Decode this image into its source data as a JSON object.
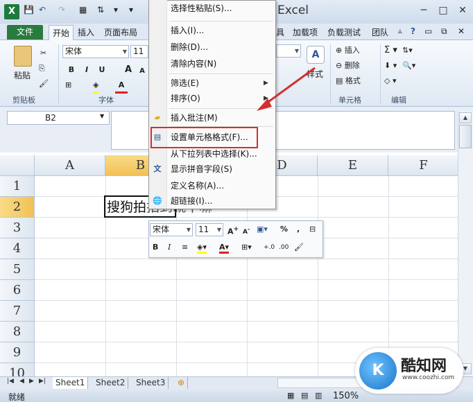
{
  "window": {
    "title": "Excel",
    "logo_letter": "X",
    "controls": [
      "─",
      "□",
      "✕"
    ]
  },
  "ribbon": {
    "file_tab": "文件",
    "tabs_left": [
      "开始",
      "插入",
      "页面布局"
    ],
    "tabs_right": [
      "具",
      "加载项",
      "负载测试",
      "团队"
    ],
    "paste_label": "粘贴",
    "group_clipboard": "剪贴板",
    "group_font": "字体",
    "group_cells": "单元格",
    "group_edit": "编辑",
    "font_name": "宋体",
    "font_size": "11",
    "bold": "B",
    "italic": "I",
    "underline": "U",
    "grow_font": "A",
    "shrink_font": "A",
    "font_color": "A",
    "style_label": "样式",
    "insert_cell": "插入",
    "delete_cell": "删除",
    "format_cell": "格式"
  },
  "formula_bar": {
    "name_box": "B2"
  },
  "grid": {
    "columns": [
      "A",
      "B",
      "C",
      "D",
      "E",
      "F"
    ],
    "rows": [
      "1",
      "2",
      "3",
      "4",
      "5",
      "6",
      "7",
      "8",
      "9",
      "10"
    ],
    "selected_column": "B",
    "selected_row": "2",
    "cell_b2_visible": "搜狗拍",
    "cell_overflow_visible": "拍到就干嘛"
  },
  "context_menu": {
    "items": [
      {
        "label": "选择性粘贴(S)...",
        "submenu": false
      },
      {
        "label": "插入(I)...",
        "submenu": false
      },
      {
        "label": "删除(D)...",
        "submenu": false
      },
      {
        "label": "清除内容(N)",
        "submenu": false
      },
      {
        "label": "筛选(E)",
        "submenu": true
      },
      {
        "label": "排序(O)",
        "submenu": true
      },
      {
        "label": "插入批注(M)",
        "submenu": false
      },
      {
        "label": "设置单元格格式(F)...",
        "submenu": false
      },
      {
        "label": "从下拉列表中选择(K)...",
        "submenu": false
      },
      {
        "label": "显示拼音字段(S)",
        "submenu": false
      },
      {
        "label": "定义名称(A)...",
        "submenu": false
      },
      {
        "label": "超链接(I)...",
        "submenu": false
      }
    ],
    "highlighted": "设置单元格格式(F)...",
    "highlight_color": "#d22f2f"
  },
  "mini_toolbar": {
    "font_name": "宋体",
    "font_size": "11",
    "bold": "B",
    "italic": "I",
    "percent": "%",
    "comma": ","
  },
  "sheets": {
    "tabs": [
      "Sheet1",
      "Sheet2",
      "Sheet3"
    ],
    "active": "Sheet1"
  },
  "status": {
    "text": "就绪",
    "zoom": "150%"
  },
  "watermark": {
    "logo_text": "K",
    "title": "酷知网",
    "url": "www.coozhi.com"
  },
  "colors": {
    "accent": "#2b7a3e",
    "selection": "#f1c054",
    "arrow": "#d22f2f"
  }
}
